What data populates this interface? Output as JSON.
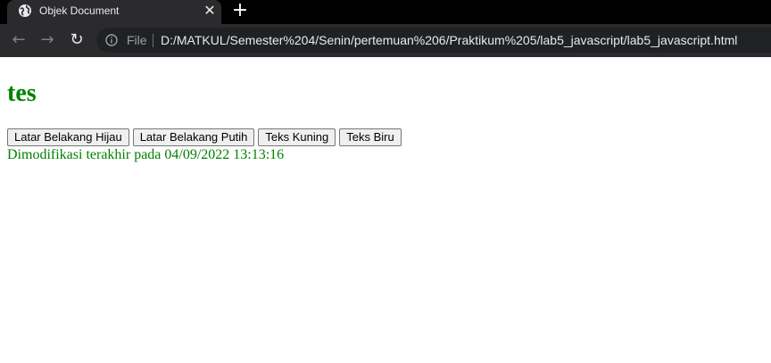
{
  "browser": {
    "tab": {
      "title": "Objek Document",
      "close_symbol": "✕",
      "favicon": "globe-icon"
    },
    "new_tab_symbol": "+",
    "nav": {
      "back_icon": "←",
      "forward_icon": "→",
      "reload_icon": "↻"
    },
    "address_bar": {
      "scheme": "File",
      "url": "D:/MATKUL/Semester%204/Senin/pertemuan%206/Praktikum%205/lab5_javascript/lab5_javascript.html"
    }
  },
  "page": {
    "heading": "tes",
    "buttons": [
      "Latar Belakang Hijau",
      "Latar Belakang Putih",
      "Teks Kuning",
      "Teks Biru"
    ],
    "last_modified": "Dimodifikasi terakhir pada 04/09/2022 13:13:16",
    "colors": {
      "text": "#008000",
      "background": "#ffffff"
    }
  }
}
